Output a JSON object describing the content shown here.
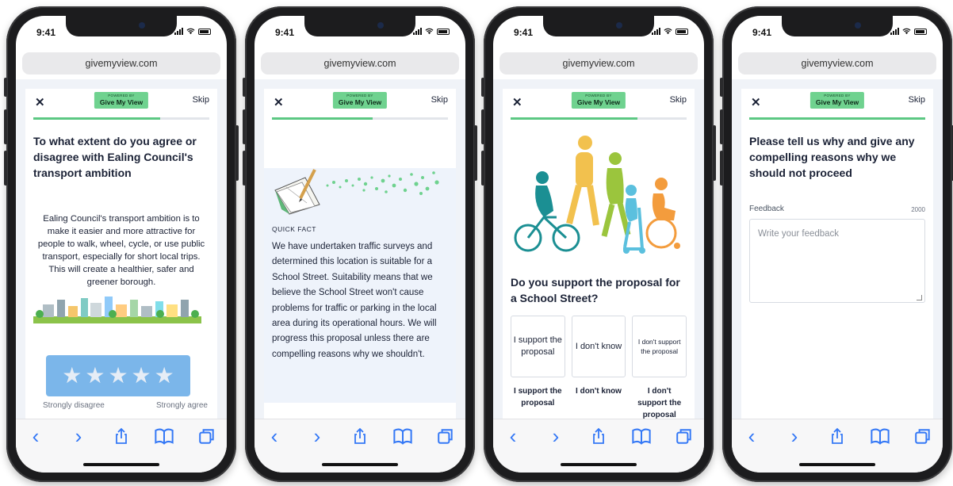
{
  "status": {
    "time": "9:41"
  },
  "browser": {
    "url": "givemyview.com"
  },
  "header": {
    "close": "✕",
    "skip": "Skip",
    "badge_powered": "POWERED BY",
    "badge_name": "Give My View"
  },
  "colors": {
    "brand_green": "#6fd28f",
    "progress_green": "#5cc883",
    "ios_blue": "#3478f6",
    "star_box": "#7bb6ea"
  },
  "screens": [
    {
      "progress": 0.72,
      "question": "To what extent do you agree or disagree with Ealing Council's transport ambition",
      "description": "Ealing Council's transport ambition is to make it easier and more attractive for people to walk, wheel, cycle, or use public transport, especially for short local trips. This will create a healthier, safer and greener borough.",
      "rating_stars": 5,
      "scale_min": "Strongly disagree",
      "scale_max": "Strongly agree"
    },
    {
      "progress": 0.57,
      "label": "QUICK FACT",
      "body": "We have undertaken traffic surveys and determined this location is suitable for a School Street. Suitability means that we believe the School Street won't cause problems for traffic or parking in the local area during its operational hours. We will progress this proposal unless there are compelling reasons why we shouldn't."
    },
    {
      "progress": 0.72,
      "question": "Do you support the proposal for a School Street?",
      "options": [
        "I support the proposal",
        "I don't know",
        "I don't support the proposal"
      ],
      "option_labels": [
        "I support the proposal",
        "I don't know",
        "I don't support the proposal"
      ]
    },
    {
      "progress": 1.0,
      "question": "Please tell us why and give any compelling reasons why we should not proceed",
      "feedback_label": "Feedback",
      "char_limit": "2000",
      "placeholder": "Write your feedback"
    }
  ],
  "toolbar": {
    "back": "‹",
    "forward": "›"
  }
}
